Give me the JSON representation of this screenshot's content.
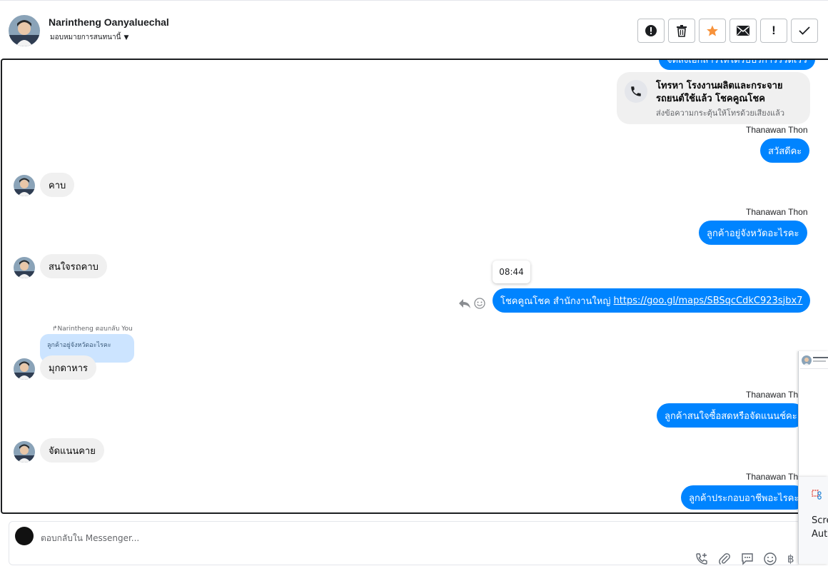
{
  "header": {
    "contact_name": "Narintheng Oanyaluechal",
    "assign_label": "มอบหมายการสนทนานี้",
    "tools": [
      "spam-report",
      "delete",
      "star",
      "mark-unread",
      "important",
      "done"
    ]
  },
  "thread": {
    "top_partial_text": "จัดส่งเอกสารให้ได้รับบริการรวดเร็ว",
    "call_card": {
      "title": "โทรหา โรงงานผลิตและกระจายรถยนต์ใช้แล้ว โชคคูณโชค",
      "subtitle": "ส่งข้อความกระตุ้นให้โทรด้วยเสียงแล้ว"
    },
    "agent_name": "Thanawan Thon",
    "messages": {
      "out_1": "สวัสดีคะ",
      "in_1": "คาบ",
      "out_2": "ลูกค้าอยู่จังหวัดอะไรคะ",
      "in_2": "สนใจรถคาบ",
      "tooltip_time": "08:44",
      "out_3_prefix": "โชคคูณโชค สำนักงานใหญ่ ",
      "out_3_link": "https://goo.gl/maps/SBSqcCdkC923sjbx7",
      "reply_note": "Narintheng ตอบกลับ You",
      "quoted_text": "ลูกค้าอยู่จังหวัดอะไรคะ",
      "in_3": "มุกดาหาร",
      "out_4": "ลูกค้าสนใจซื้อสดหรือจัดแนนช์คะ",
      "in_4": "จัดแนนคาย",
      "out_5": "ลูกค้าประกอบอาชีพอะไรคะ"
    }
  },
  "composer": {
    "placeholder": "ตอบกลับใน Messenger..."
  },
  "notification": {
    "line1": "Scre",
    "line2": "Auto"
  },
  "colors": {
    "outgoing_bubble": "#0084ff",
    "incoming_bubble": "#f0f0f0",
    "star": "#f7923a"
  }
}
